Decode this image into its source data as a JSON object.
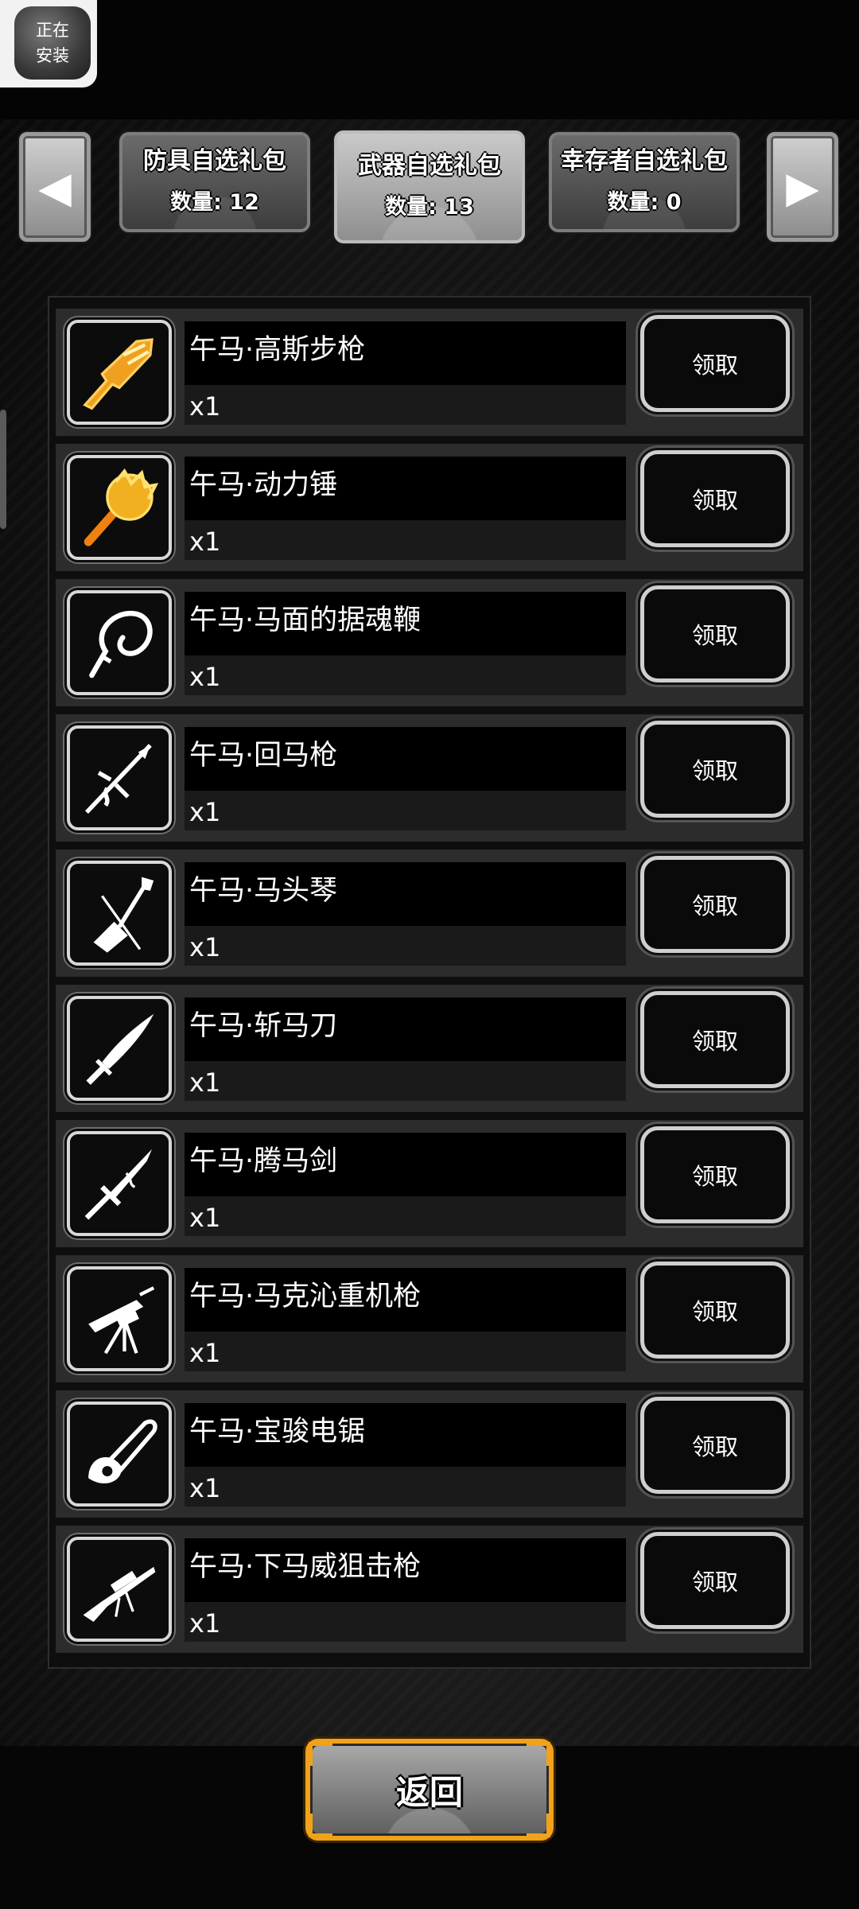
{
  "status_badge": {
    "line1": "正在",
    "line2": "安装"
  },
  "tabs": {
    "prev_arrow": "◀",
    "next_arrow": "▶",
    "items": [
      {
        "title": "防具自选礼包",
        "count": "数量: 12",
        "active": false
      },
      {
        "title": "武器自选礼包",
        "count": "数量: 13",
        "active": true
      },
      {
        "title": "幸存者自选礼包",
        "count": "数量: 0",
        "active": false
      }
    ]
  },
  "items": [
    {
      "name": "午马·高斯步枪",
      "qty": "x1",
      "claim": "领取",
      "icon": "gold-rifle-icon",
      "icon_color": "#f0a020"
    },
    {
      "name": "午马·动力锤",
      "qty": "x1",
      "claim": "领取",
      "icon": "gold-hammer-icon",
      "icon_color": "#f0a020"
    },
    {
      "name": "午马·马面的据魂鞭",
      "qty": "x1",
      "claim": "领取",
      "icon": "whip-icon",
      "icon_color": "#ffffff"
    },
    {
      "name": "午马·回马枪",
      "qty": "x1",
      "claim": "领取",
      "icon": "spear-icon",
      "icon_color": "#ffffff"
    },
    {
      "name": "午马·马头琴",
      "qty": "x1",
      "claim": "领取",
      "icon": "horsehead-fiddle-icon",
      "icon_color": "#ffffff"
    },
    {
      "name": "午马·斩马刀",
      "qty": "x1",
      "claim": "领取",
      "icon": "blade-icon",
      "icon_color": "#ffffff"
    },
    {
      "name": "午马·腾马剑",
      "qty": "x1",
      "claim": "领取",
      "icon": "sword-icon",
      "icon_color": "#ffffff"
    },
    {
      "name": "午马·马克沁重机枪",
      "qty": "x1",
      "claim": "领取",
      "icon": "machine-gun-icon",
      "icon_color": "#ffffff"
    },
    {
      "name": "午马·宝骏电锯",
      "qty": "x1",
      "claim": "领取",
      "icon": "chainsaw-icon",
      "icon_color": "#ffffff"
    },
    {
      "name": "午马·下马威狙击枪",
      "qty": "x1",
      "claim": "领取",
      "icon": "sniper-rifle-icon",
      "icon_color": "#ffffff"
    }
  ],
  "footer": {
    "return_label": "返回"
  }
}
